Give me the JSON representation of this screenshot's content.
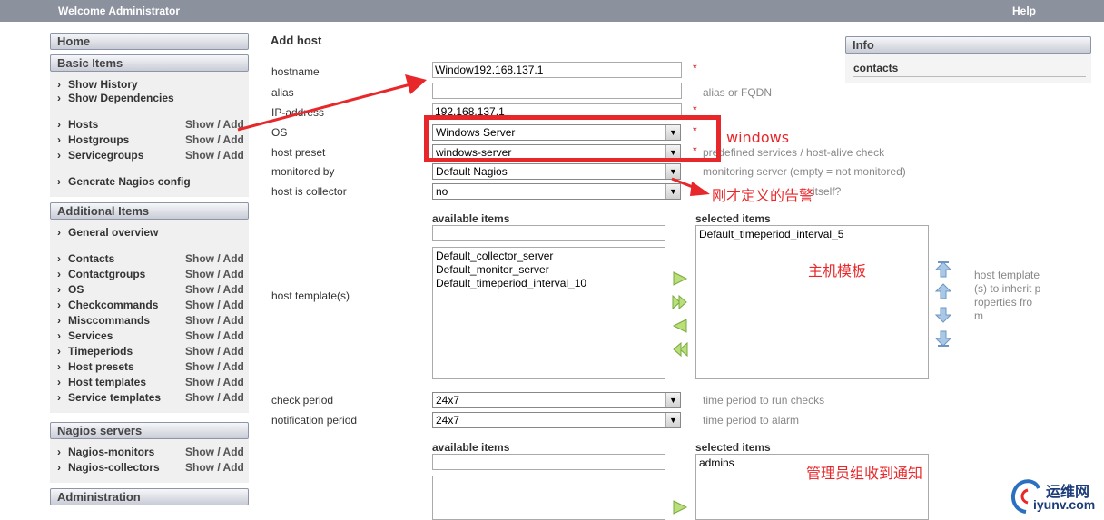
{
  "topbar": {
    "welcome": "Welcome Administrator",
    "help": "Help"
  },
  "sidebar": {
    "home": "Home",
    "basic": {
      "title": "Basic Items",
      "items": [
        {
          "label": "Show History"
        },
        {
          "label": "Show Dependencies"
        }
      ],
      "items2": [
        {
          "label": "Hosts",
          "action": "Show / Add"
        },
        {
          "label": "Hostgroups",
          "action": "Show / Add"
        },
        {
          "label": "Servicegroups",
          "action": "Show / Add"
        }
      ],
      "generate": "Generate Nagios config"
    },
    "additional": {
      "title": "Additional Items",
      "overview": "General overview",
      "items": [
        {
          "label": "Contacts",
          "action": "Show / Add"
        },
        {
          "label": "Contactgroups",
          "action": "Show / Add"
        },
        {
          "label": "OS",
          "action": "Show / Add"
        },
        {
          "label": "Checkcommands",
          "action": "Show / Add"
        },
        {
          "label": "Misccommands",
          "action": "Show / Add"
        },
        {
          "label": "Services",
          "action": "Show / Add"
        },
        {
          "label": "Timeperiods",
          "action": "Show / Add"
        },
        {
          "label": "Host presets",
          "action": "Show / Add"
        },
        {
          "label": "Host templates",
          "action": "Show / Add"
        },
        {
          "label": "Service templates",
          "action": "Show / Add"
        }
      ]
    },
    "servers": {
      "title": "Nagios servers",
      "items": [
        {
          "label": "Nagios-monitors",
          "action": "Show / Add"
        },
        {
          "label": "Nagios-collectors",
          "action": "Show / Add"
        }
      ]
    },
    "administration": "Administration"
  },
  "form": {
    "title": "Add host",
    "hostname": {
      "label": "hostname",
      "value": "Window192.168.137.1",
      "required": "*"
    },
    "alias": {
      "label": "alias",
      "value": "",
      "hint": "alias or FQDN"
    },
    "ip": {
      "label": "IP-address",
      "value": "192.168.137.1",
      "required": "*"
    },
    "os": {
      "label": "OS",
      "value": "Windows Server",
      "required": "*"
    },
    "preset": {
      "label": "host preset",
      "value": "windows-server",
      "required": "*",
      "hint": "predefined services / host-alive check"
    },
    "monitored": {
      "label": "monitored by",
      "value": "Default Nagios",
      "hint": "monitoring server (empty = not monitored)"
    },
    "collector": {
      "label": "host is collector",
      "value": "no",
      "hint": "itself?"
    },
    "templates": {
      "label": "host template(s)",
      "available_title": "available items",
      "selected_title": "selected items",
      "available": [
        "Default_collector_server",
        "Default_monitor_server",
        "Default_timeperiod_interval_10"
      ],
      "selected": [
        "Default_timeperiod_interval_5"
      ],
      "hint": [
        "host template",
        "(s) to inherit p",
        "roperties fro",
        "m"
      ]
    },
    "check_period": {
      "label": "check period",
      "value": "24x7",
      "hint": "time period to run checks"
    },
    "notification_period": {
      "label": "notification period",
      "value": "24x7",
      "hint": "time period to alarm"
    },
    "contacts": {
      "available_title": "available items",
      "selected_title": "selected items",
      "selected": [
        "admins"
      ]
    }
  },
  "info": {
    "title": "Info",
    "contacts": "contacts"
  },
  "annotations": {
    "windows": "windows",
    "alarm": "刚才定义的告警",
    "host_template": "主机模板",
    "admin_group": "管理员组收到通知",
    "accent_color": "#e8272a"
  },
  "watermark": {
    "cn": "运维网",
    "url": "iyunv.com"
  }
}
